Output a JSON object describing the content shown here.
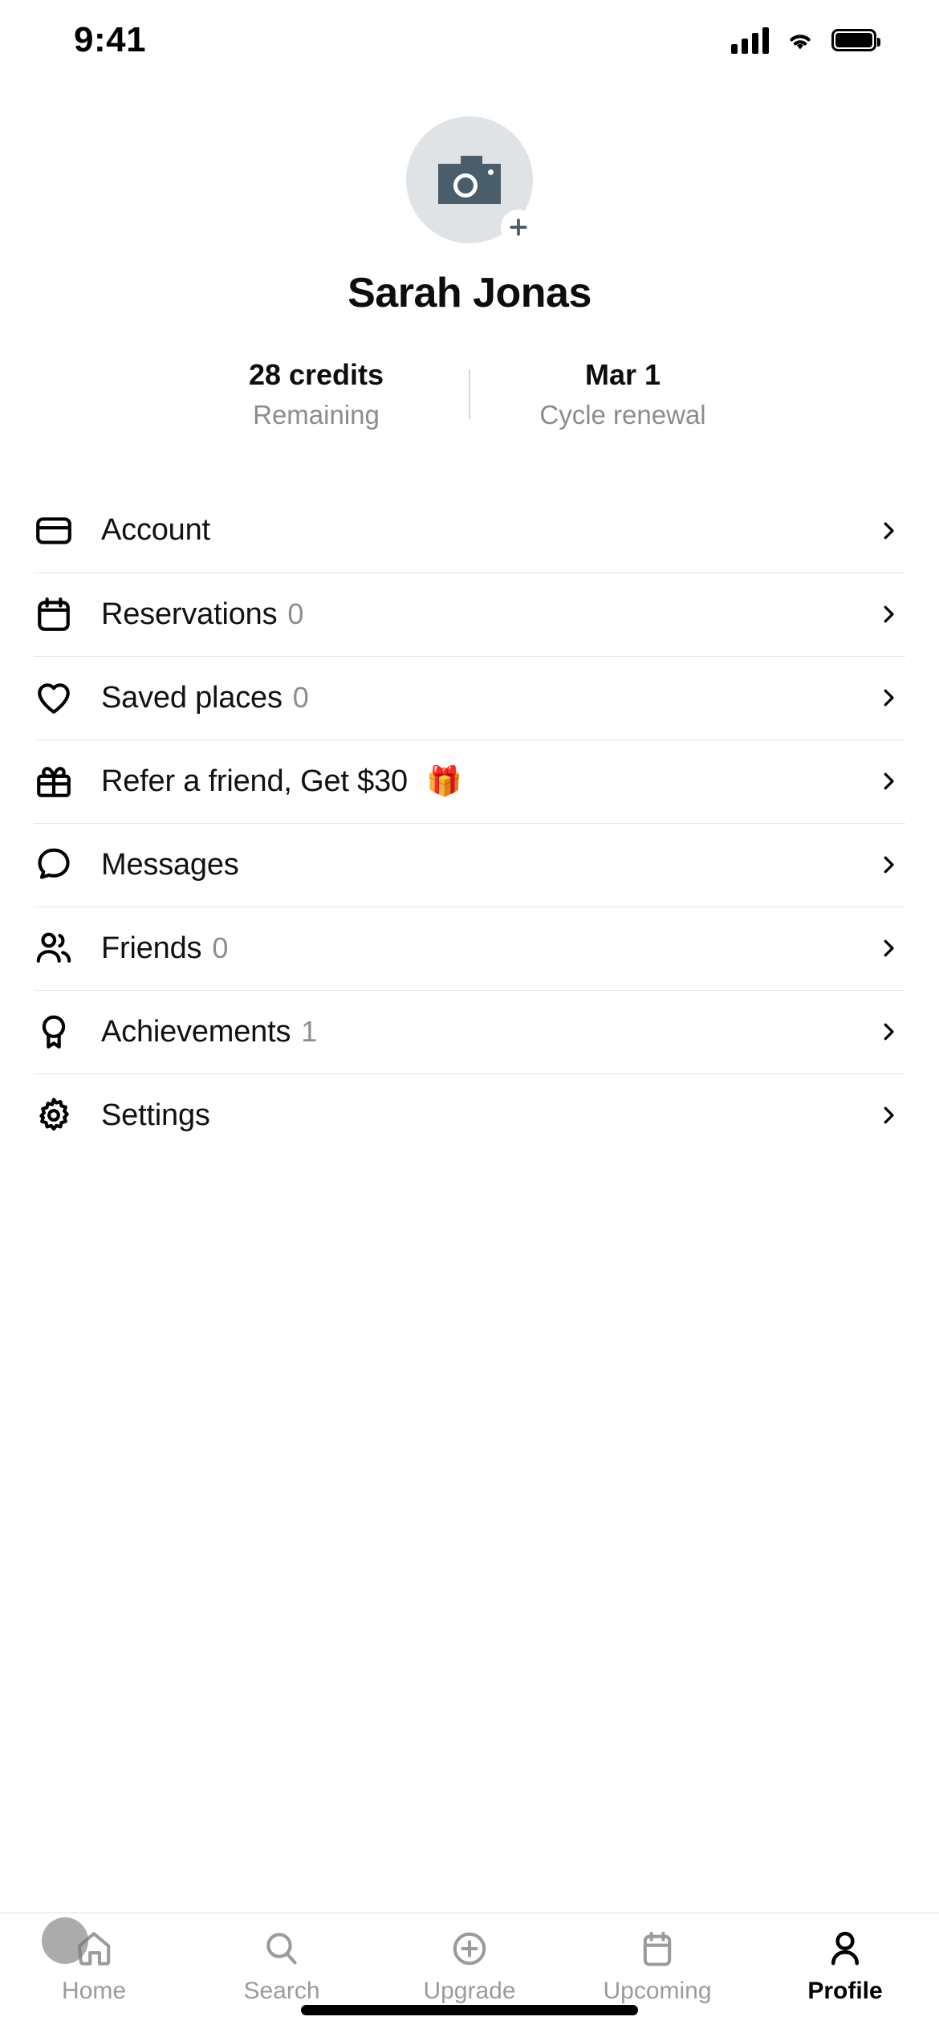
{
  "status_bar": {
    "time": "9:41",
    "signal_icon": "cellular-bars-icon",
    "wifi_icon": "wifi-icon",
    "battery_icon": "battery-full-icon"
  },
  "profile": {
    "avatar_icon": "camera-placeholder-icon",
    "avatar_add_badge_icon": "plus-circle-icon",
    "name": "Sarah Jonas",
    "stats": [
      {
        "value": "28 credits",
        "label": "Remaining"
      },
      {
        "value": "Mar 1",
        "label": "Cycle renewal"
      }
    ]
  },
  "menu": {
    "items": [
      {
        "icon": "credit-card-icon",
        "label": "Account",
        "count": "",
        "emoji": "",
        "chevron": "chevron-right-icon"
      },
      {
        "icon": "calendar-icon",
        "label": "Reservations",
        "count": "0",
        "emoji": "",
        "chevron": "chevron-right-icon"
      },
      {
        "icon": "heart-icon",
        "label": "Saved places",
        "count": "0",
        "emoji": "",
        "chevron": "chevron-right-icon"
      },
      {
        "icon": "gift-icon",
        "label": "Refer a friend, Get $30",
        "count": "",
        "emoji": "🎁",
        "chevron": "chevron-right-icon"
      },
      {
        "icon": "chat-bubble-icon",
        "label": "Messages",
        "count": "",
        "emoji": "",
        "chevron": "chevron-right-icon"
      },
      {
        "icon": "people-icon",
        "label": "Friends",
        "count": "0",
        "emoji": "",
        "chevron": "chevron-right-icon"
      },
      {
        "icon": "medal-icon",
        "label": "Achievements",
        "count": "1",
        "emoji": "",
        "chevron": "chevron-right-icon"
      },
      {
        "icon": "gear-icon",
        "label": "Settings",
        "count": "",
        "emoji": "",
        "chevron": "chevron-right-icon"
      }
    ]
  },
  "tab_bar": {
    "tabs": [
      {
        "icon": "home-icon",
        "label": "Home",
        "active": false
      },
      {
        "icon": "search-icon",
        "label": "Search",
        "active": false
      },
      {
        "icon": "plus-circle-icon",
        "label": "Upgrade",
        "active": false
      },
      {
        "icon": "calendar-icon",
        "label": "Upcoming",
        "active": false
      },
      {
        "icon": "person-icon",
        "label": "Profile",
        "active": true
      }
    ]
  },
  "colors": {
    "text_primary": "#0d0d0d",
    "text_muted": "#8c8c8c",
    "divider": "#e6e6e6",
    "avatar_bg": "#dfe3e6",
    "camera": "#4a5d6b"
  }
}
